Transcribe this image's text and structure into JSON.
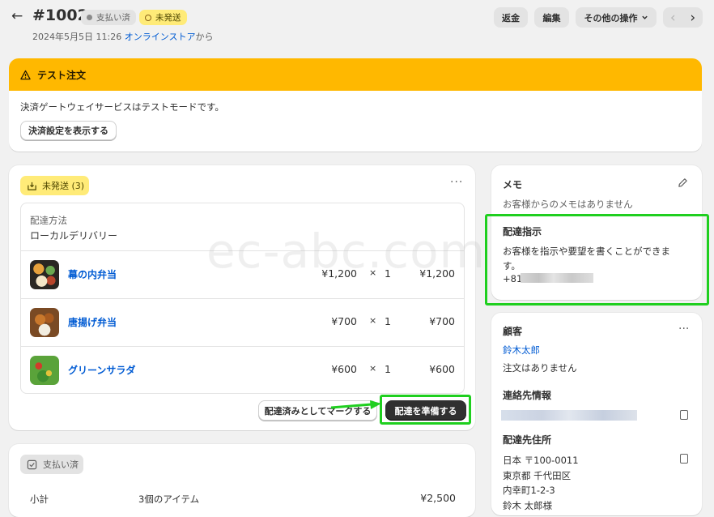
{
  "header": {
    "back_glyph": "←",
    "order_number": "#1002",
    "badge_paid": "支払い済",
    "badge_unfulfilled": "未発送",
    "date_text": "2024年5月5日 11:26",
    "store_link": "オンラインストア",
    "from_text": "から",
    "btn_refund": "返金",
    "btn_edit": "編集",
    "btn_more": "その他の操作",
    "nav_prev": "‹",
    "nav_next": "›"
  },
  "test_banner": {
    "title": "テスト注文",
    "message": "決済ゲートウェイサービスはテストモードです。",
    "button": "決済設定を表示する"
  },
  "fulfillment": {
    "badge": "未発送 (3)",
    "method_label": "配達方法",
    "method_value": "ローカルデリバリー",
    "items": [
      {
        "name": "幕の内弁当",
        "price": "¥1,200",
        "qty_sign": "×",
        "qty": "1",
        "total": "¥1,200"
      },
      {
        "name": "唐揚げ弁当",
        "price": "¥700",
        "qty_sign": "×",
        "qty": "1",
        "total": "¥700"
      },
      {
        "name": "グリーンサラダ",
        "price": "¥600",
        "qty_sign": "×",
        "qty": "1",
        "total": "¥600"
      }
    ],
    "btn_mark_delivered": "配達済みとしてマークする",
    "btn_prepare": "配達を準備する"
  },
  "payment": {
    "badge": "支払い済",
    "subtotal_label": "小計",
    "subtotal_items": "3個のアイテム",
    "subtotal_value": "¥2,500"
  },
  "memo": {
    "title": "メモ",
    "empty": "お客様からのメモはありません"
  },
  "delivery_instructions": {
    "title": "配達指示",
    "text": "お客様を指示や要望を書くことができます。",
    "phone_prefix": "+81"
  },
  "customer": {
    "title": "顧客",
    "name": "鈴木太郎",
    "orders": "注文はありません",
    "contact_title": "連絡先情報",
    "address_title": "配達先住所",
    "address_lines": [
      "日本 〒100-0011",
      "東京都 千代田区",
      "内幸町1-2-3",
      "鈴木 太郎様"
    ]
  },
  "watermark": "ec-abc.com",
  "colors": {
    "accent_yellow": "#ffb800",
    "link_blue": "#005bd3",
    "highlight_green": "#1fcf1f"
  }
}
